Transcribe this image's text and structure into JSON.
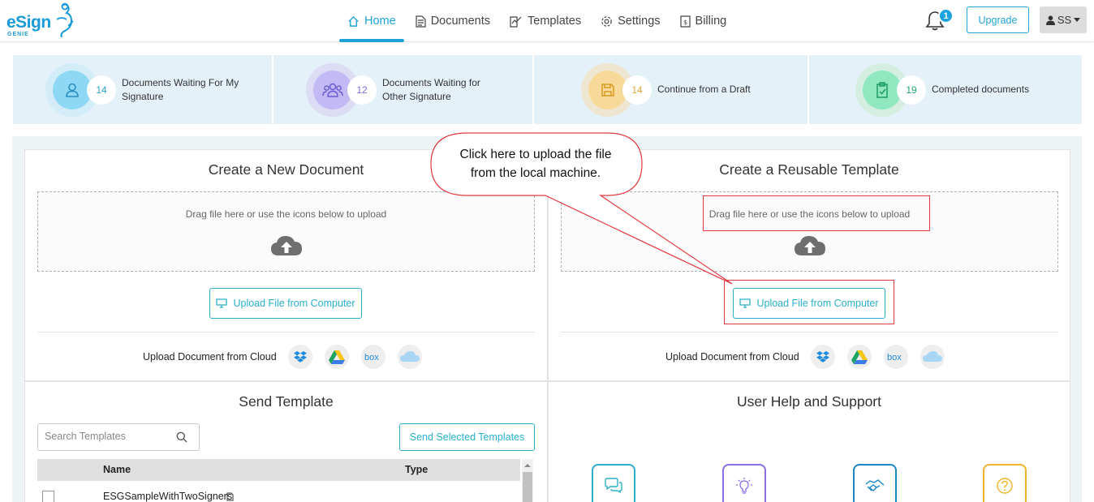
{
  "header": {
    "logo_text": "eSign",
    "logo_sub": "GENIE",
    "nav": [
      {
        "label": "Home",
        "icon": "home-icon",
        "active": true
      },
      {
        "label": "Documents",
        "icon": "document-icon",
        "active": false
      },
      {
        "label": "Templates",
        "icon": "template-icon",
        "active": false
      },
      {
        "label": "Settings",
        "icon": "gear-icon",
        "active": false
      },
      {
        "label": "Billing",
        "icon": "billing-icon",
        "active": false
      }
    ],
    "notification_count": "1",
    "upgrade_label": "Upgrade",
    "user_initials": "SS"
  },
  "stats": [
    {
      "count": "14",
      "label_line1": "Documents Waiting For My",
      "label_line2": "Signature",
      "color": "#5bc8f0"
    },
    {
      "count": "12",
      "label_line1": "Documents Waiting for",
      "label_line2": "Other Signature",
      "color": "#a79bf0"
    },
    {
      "count": "14",
      "label_line1": "Continue from a Draft",
      "label_line2": "",
      "color": "#f3c46a"
    },
    {
      "count": "19",
      "label_line1": "Completed documents",
      "label_line2": "",
      "color": "#4fd69b"
    }
  ],
  "create_document": {
    "title": "Create a New Document",
    "drop_text": "Drag file here or use the icons below to upload",
    "upload_label": "Upload File from Computer",
    "cloud_label": "Upload Document from Cloud"
  },
  "create_template": {
    "title": "Create a Reusable Template",
    "drop_text": "Drag file here or use the icons below to upload",
    "upload_label": "Upload File from Computer",
    "cloud_label": "Upload Document from Cloud"
  },
  "send_template": {
    "title": "Send Template",
    "search_placeholder": "Search Templates",
    "send_selected_label": "Send Selected Templates",
    "columns": [
      "Name",
      "Type"
    ],
    "rows": [
      {
        "name": "ESGSampleWithTwoSigners"
      }
    ]
  },
  "help": {
    "title": "User Help and Support",
    "icons": [
      {
        "name": "chat-icon",
        "color": "#2ab0c9"
      },
      {
        "name": "lightbulb-icon",
        "color": "#8a6ee6"
      },
      {
        "name": "handshake-icon",
        "color": "#1a86c8"
      },
      {
        "name": "question-icon",
        "color": "#f0b429"
      }
    ]
  },
  "annotation": {
    "line1": "Click here to upload the file",
    "line2": "from the local machine."
  },
  "cloud_services": [
    "dropbox-icon",
    "google-drive-icon",
    "box-icon",
    "onedrive-icon"
  ],
  "colors": {
    "accent": "#1fa3d7",
    "teal": "#2ab0c9",
    "annotation_red": "#e0393e"
  }
}
